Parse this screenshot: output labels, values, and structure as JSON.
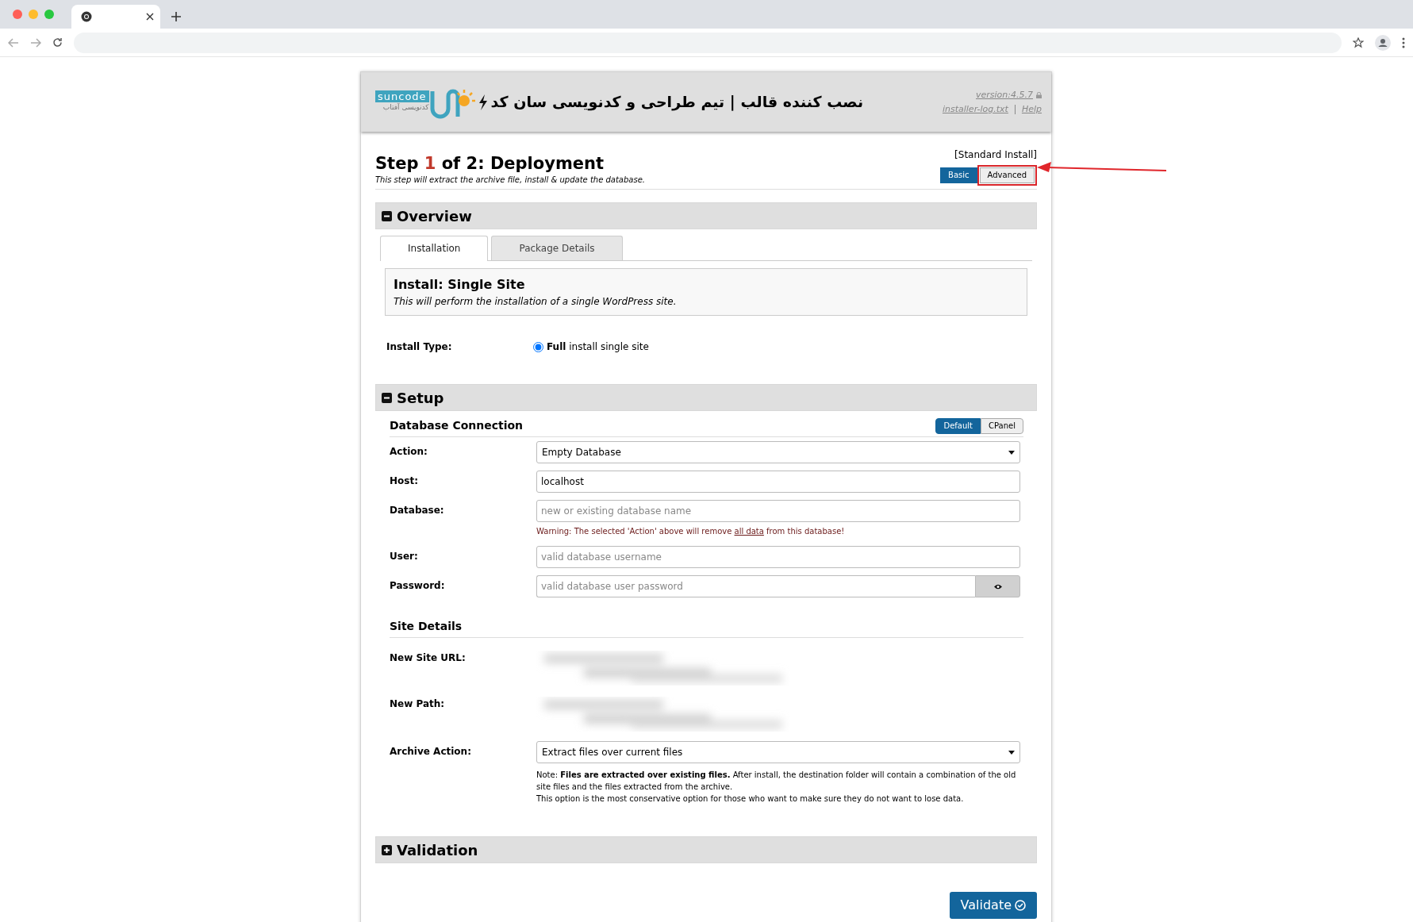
{
  "header": {
    "logo_text": "suncode",
    "logo_subtext": "کدنویسی آفتاب",
    "title": "نصب کننده قالب | تیم طراحی و کدنویسی سان کد",
    "version": "version:4.5.7",
    "links": [
      "installer-log.txt",
      "Help"
    ]
  },
  "step": {
    "prefix": "Step",
    "number": "1",
    "suffix": "of 2: Deployment",
    "description": "This step will extract the archive file, install & update the database.",
    "install_mode": "[Standard Install]",
    "view_modes": [
      {
        "label": "Basic",
        "selected": true,
        "highlighted": false
      },
      {
        "label": "Advanced",
        "selected": false,
        "highlighted": true
      }
    ]
  },
  "overview": {
    "title": "Overview",
    "expanded": true,
    "tabs": [
      {
        "label": "Installation",
        "selected": true
      },
      {
        "label": "Package Details",
        "selected": false
      }
    ],
    "install_box": {
      "title": "Install: Single Site",
      "text": "This will perform the installation of a single WordPress site."
    },
    "install_type": {
      "label": "Install Type:",
      "options": [
        {
          "label": "**Full** install single site",
          "selected": true
        }
      ]
    }
  },
  "setup": {
    "title": "Setup",
    "expanded": true,
    "database": {
      "title": "Database Connection",
      "modes": [
        {
          "label": "Default",
          "selected": true
        },
        {
          "label": "CPanel",
          "selected": false
        }
      ],
      "fields": [
        {
          "kind": "select",
          "label": "Action:",
          "value": "Empty Database"
        },
        {
          "kind": "text",
          "label": "Host:",
          "value": "localhost"
        },
        {
          "kind": "text",
          "label": "Database:",
          "placeholder": "new or existing database name",
          "warning": {
            "before": "Warning: The selected 'Action' above will remove ",
            "link": "all data",
            "after": " from this database!"
          }
        },
        {
          "kind": "text",
          "label": "User:",
          "placeholder": "valid database username"
        },
        {
          "kind": "password",
          "label": "Password:",
          "placeholder": "valid database user password"
        }
      ]
    },
    "site": {
      "title": "Site Details",
      "fields": [
        {
          "kind": "blurred",
          "label": "New Site URL:"
        },
        {
          "kind": "blurred",
          "label": "New Path:"
        },
        {
          "kind": "select",
          "label": "Archive Action:",
          "value": "Extract files over current files",
          "notes": [
            "Note: **Files are extracted over existing files.** After install, the destination folder will contain a combination of the old site files and the files extracted from the archive.",
            "This option is the most conservative option for those who want to make sure they do not want to lose data."
          ]
        }
      ]
    }
  },
  "validation": {
    "title": "Validation",
    "expanded": false
  },
  "validate_button": "Validate"
}
